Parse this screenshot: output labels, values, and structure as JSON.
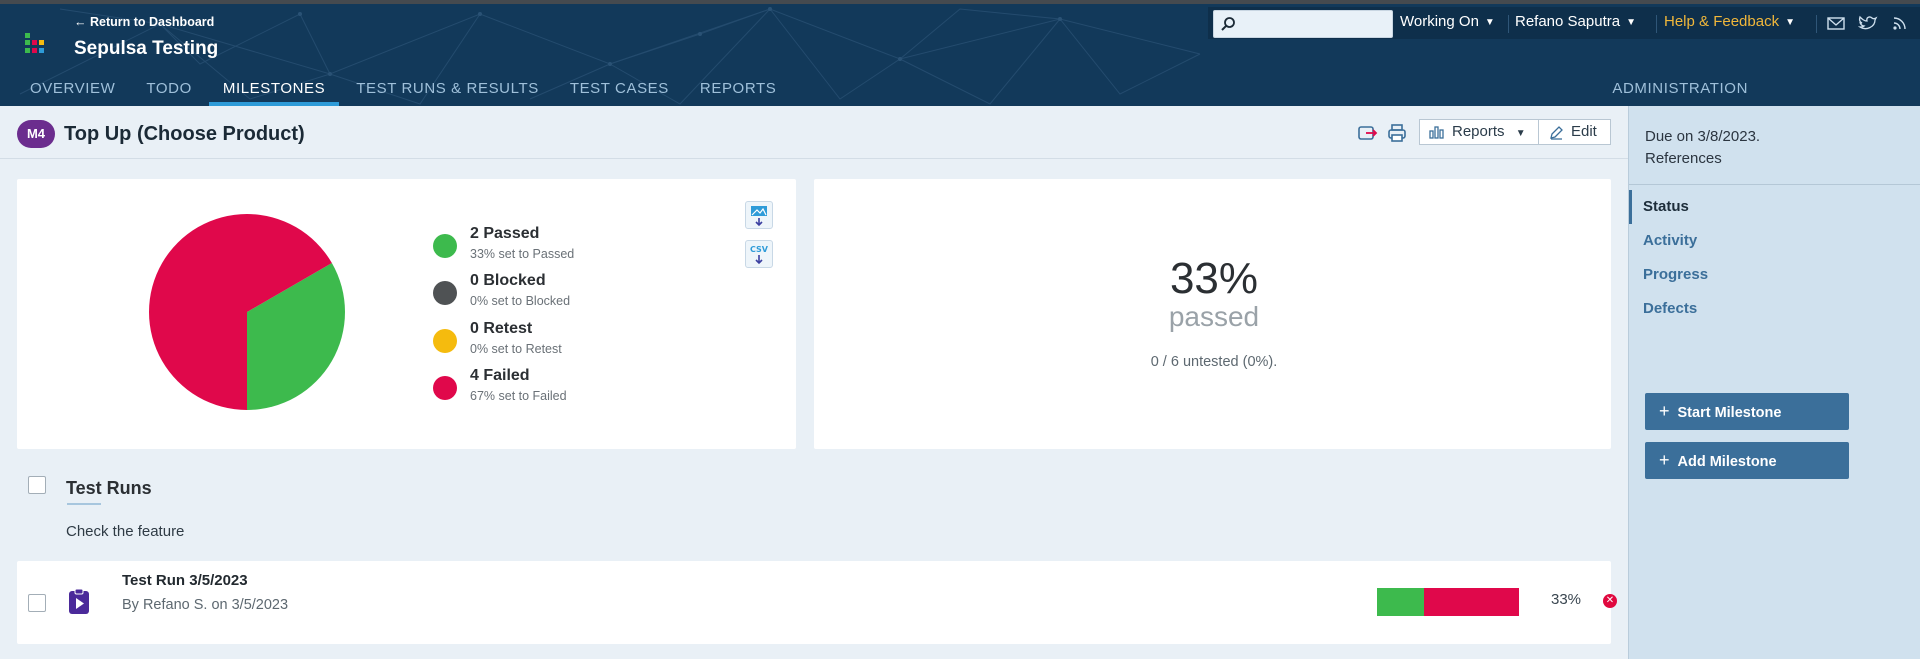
{
  "header": {
    "return_link": "← Return to Dashboard",
    "project_title": "Sepulsa Testing",
    "tabs": [
      {
        "label": "OVERVIEW"
      },
      {
        "label": "TODO"
      },
      {
        "label": "MILESTONES"
      },
      {
        "label": "TEST RUNS & RESULTS"
      },
      {
        "label": "TEST CASES"
      },
      {
        "label": "REPORTS"
      }
    ],
    "active_tab": "MILESTONES",
    "admin_tab": "ADMINISTRATION",
    "search_placeholder": "",
    "working_on": "Working On",
    "user_name": "Refano Saputra",
    "help": "Help & Feedback",
    "colors": {
      "bar": "#12395a",
      "accent_help": "#f0b73b"
    }
  },
  "milestone": {
    "badge": "M4",
    "title": "Top Up (Choose Product)",
    "reports_label": "Reports",
    "edit_label": "Edit"
  },
  "status": {
    "legend": [
      {
        "label": "2 Passed",
        "sub": "33% set to Passed",
        "color": "#3dba4d"
      },
      {
        "label": "0 Blocked",
        "sub": "0% set to Blocked",
        "color": "#4f5254"
      },
      {
        "label": "0 Retest",
        "sub": "0% set to Retest",
        "color": "#f5bb0e"
      },
      {
        "label": "4 Failed",
        "sub": "67% set to Failed",
        "color": "#e0084b"
      }
    ],
    "percent": "33%",
    "percent_label": "passed",
    "untested": "0 / 6 untested (0%)."
  },
  "chart_data": {
    "type": "pie",
    "categories": [
      "Passed",
      "Blocked",
      "Retest",
      "Failed"
    ],
    "values": [
      2,
      0,
      0,
      4
    ],
    "colors": [
      "#3dba4d",
      "#4f5254",
      "#f5bb0e",
      "#e0084b"
    ]
  },
  "test_runs": {
    "section_title": "Test Runs",
    "description": "Check the feature",
    "runs": [
      {
        "title": "Test Run 3/5/2023",
        "meta": "By Refano S. on 3/5/2023",
        "passed_fraction": 0.33,
        "failed_fraction": 0.67,
        "percent": "33%"
      }
    ]
  },
  "sidebar": {
    "due": "Due on 3/8/2023.",
    "references": "References",
    "nav": [
      {
        "label": "Status"
      },
      {
        "label": "Activity"
      },
      {
        "label": "Progress"
      },
      {
        "label": "Defects"
      }
    ],
    "active_nav": "Status",
    "start_button": "Start Milestone",
    "add_button": "Add Milestone"
  }
}
